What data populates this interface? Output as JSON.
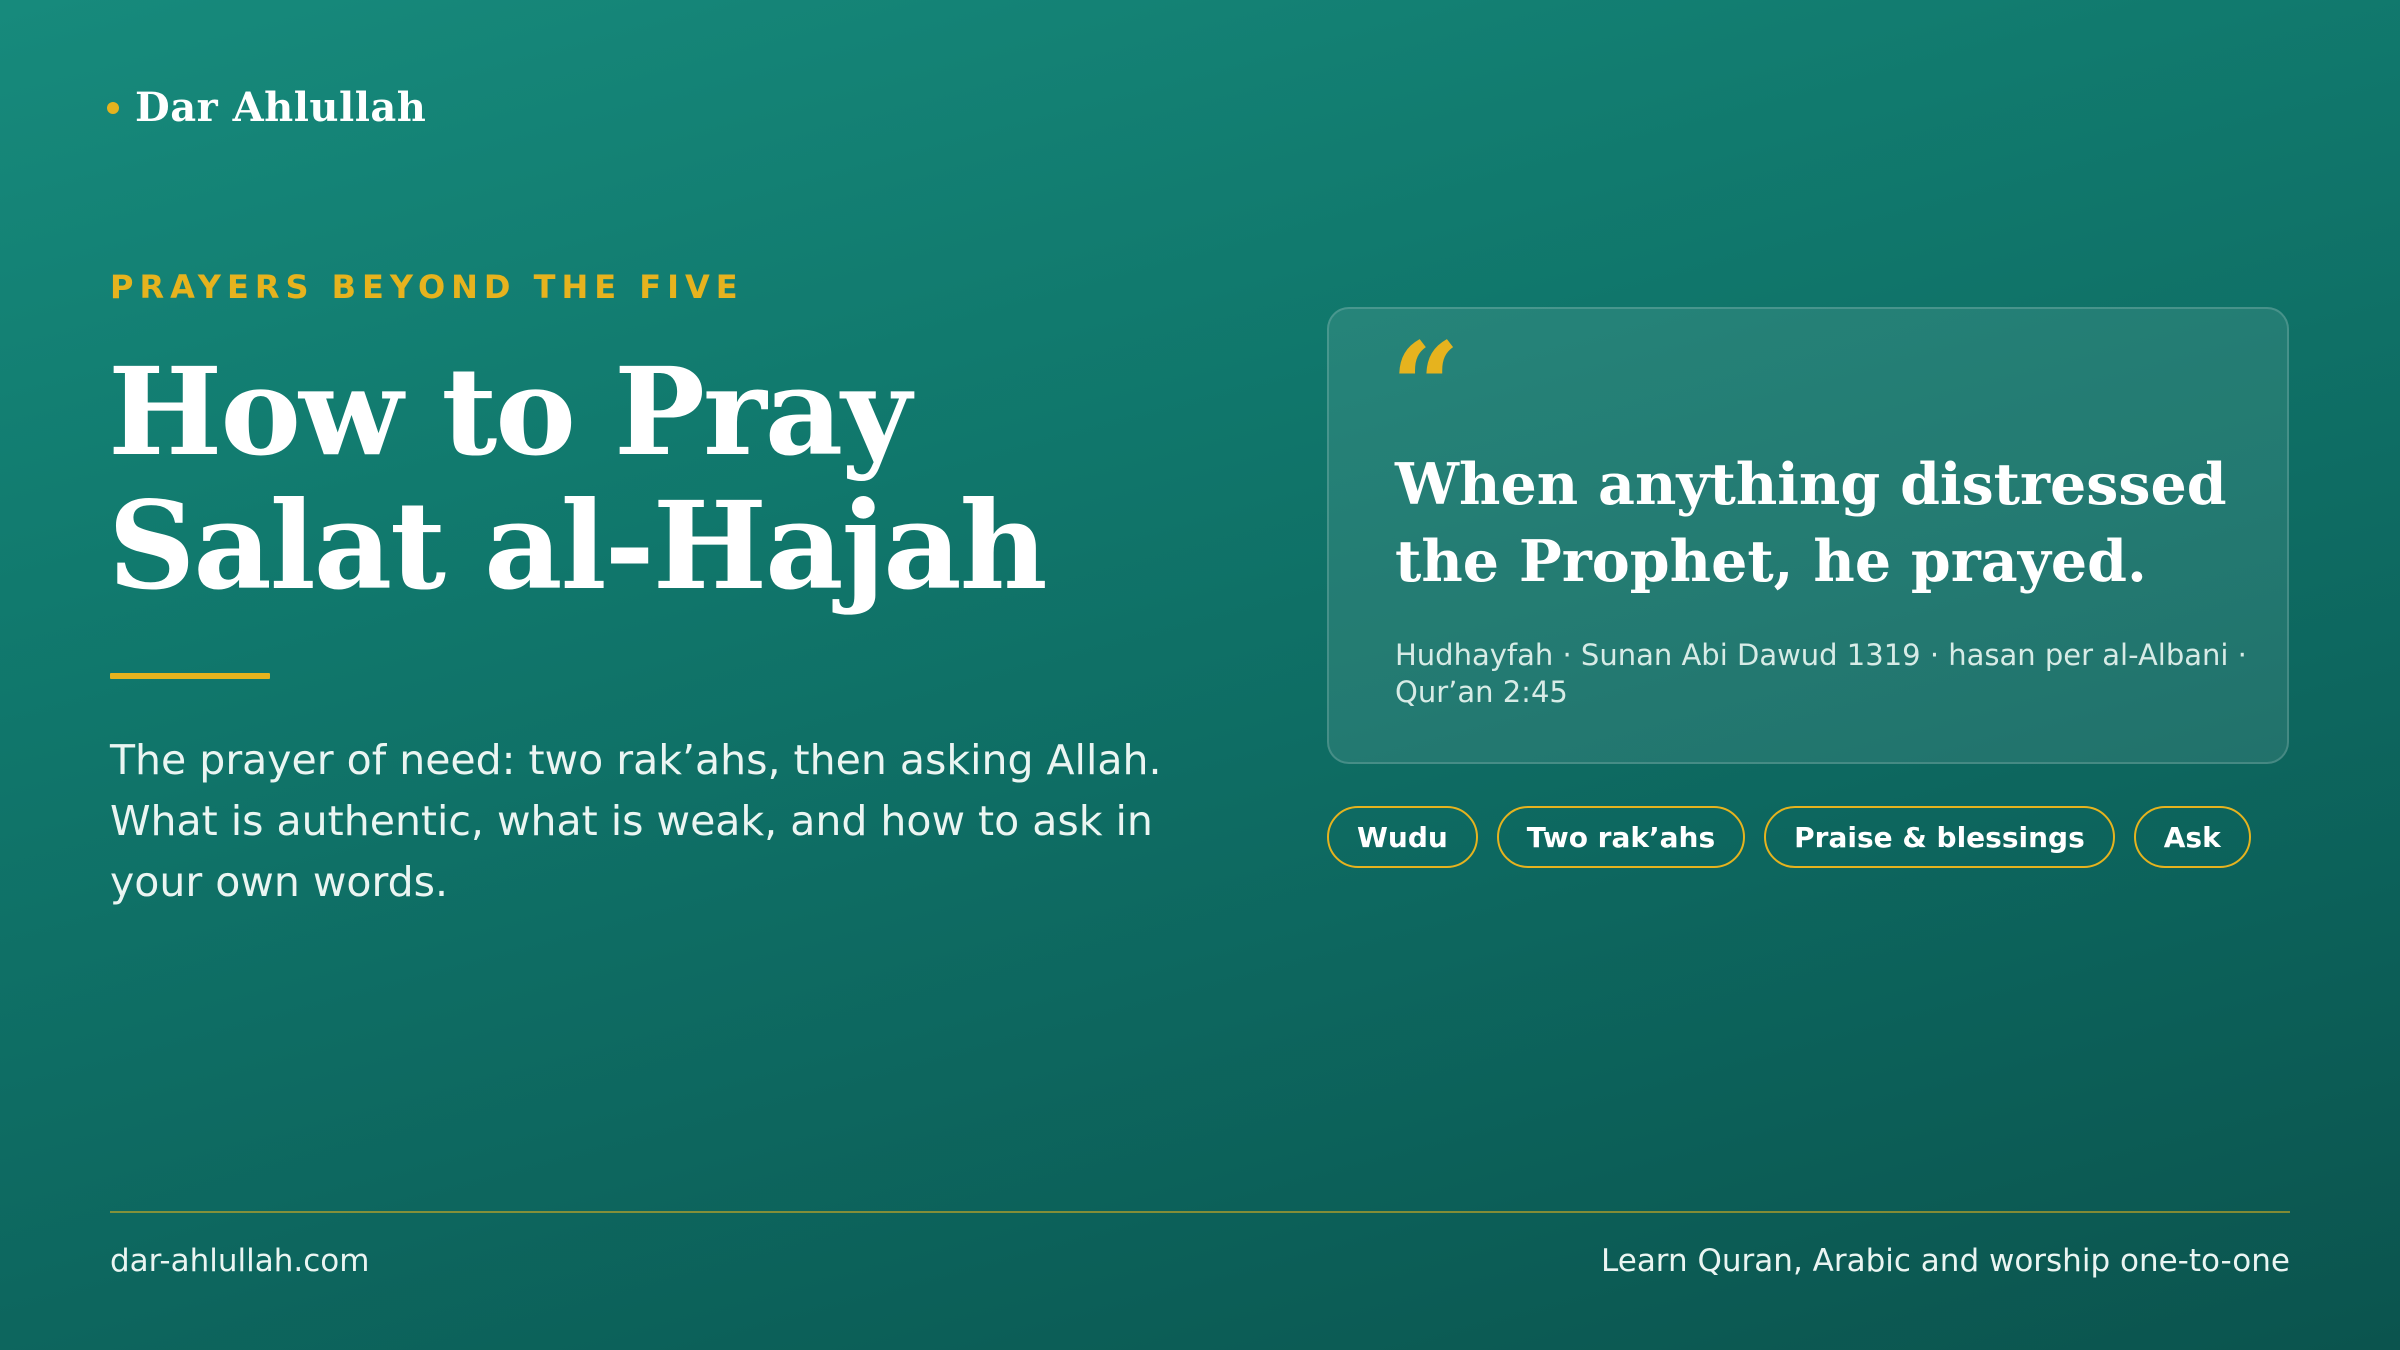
{
  "brand": {
    "name": "Dar Ahlullah",
    "accent_color": "#e6b31e"
  },
  "hero": {
    "kicker": "PRAYERS BEYOND THE FIVE",
    "title_line_1": "How to Pray",
    "title_line_2": "Salat al-Hajah",
    "intro": "The prayer of need: two rak’ahs, then asking Allah. What is authentic, what is weak, and how to ask in your own words."
  },
  "quote": {
    "mark": "“",
    "text": "When anything distressed the Prophet, he prayed.",
    "citation": "Hudhayfah · Sunan Abi Dawud 1319 · hasan per al-Albani · Qur’an 2:45"
  },
  "tags": [
    {
      "label": "Wudu"
    },
    {
      "label": "Two rak’ahs"
    },
    {
      "label": "Praise & blessings"
    },
    {
      "label": "Ask"
    }
  ],
  "footer": {
    "website": "dar-ahlullah.com",
    "tagline": "Learn Quran, Arabic and worship one-to-one"
  },
  "colors": {
    "background_top": "#178a7c",
    "background_bottom": "#0b544e",
    "gold": "#e6b31e",
    "text": "#ffffff"
  }
}
